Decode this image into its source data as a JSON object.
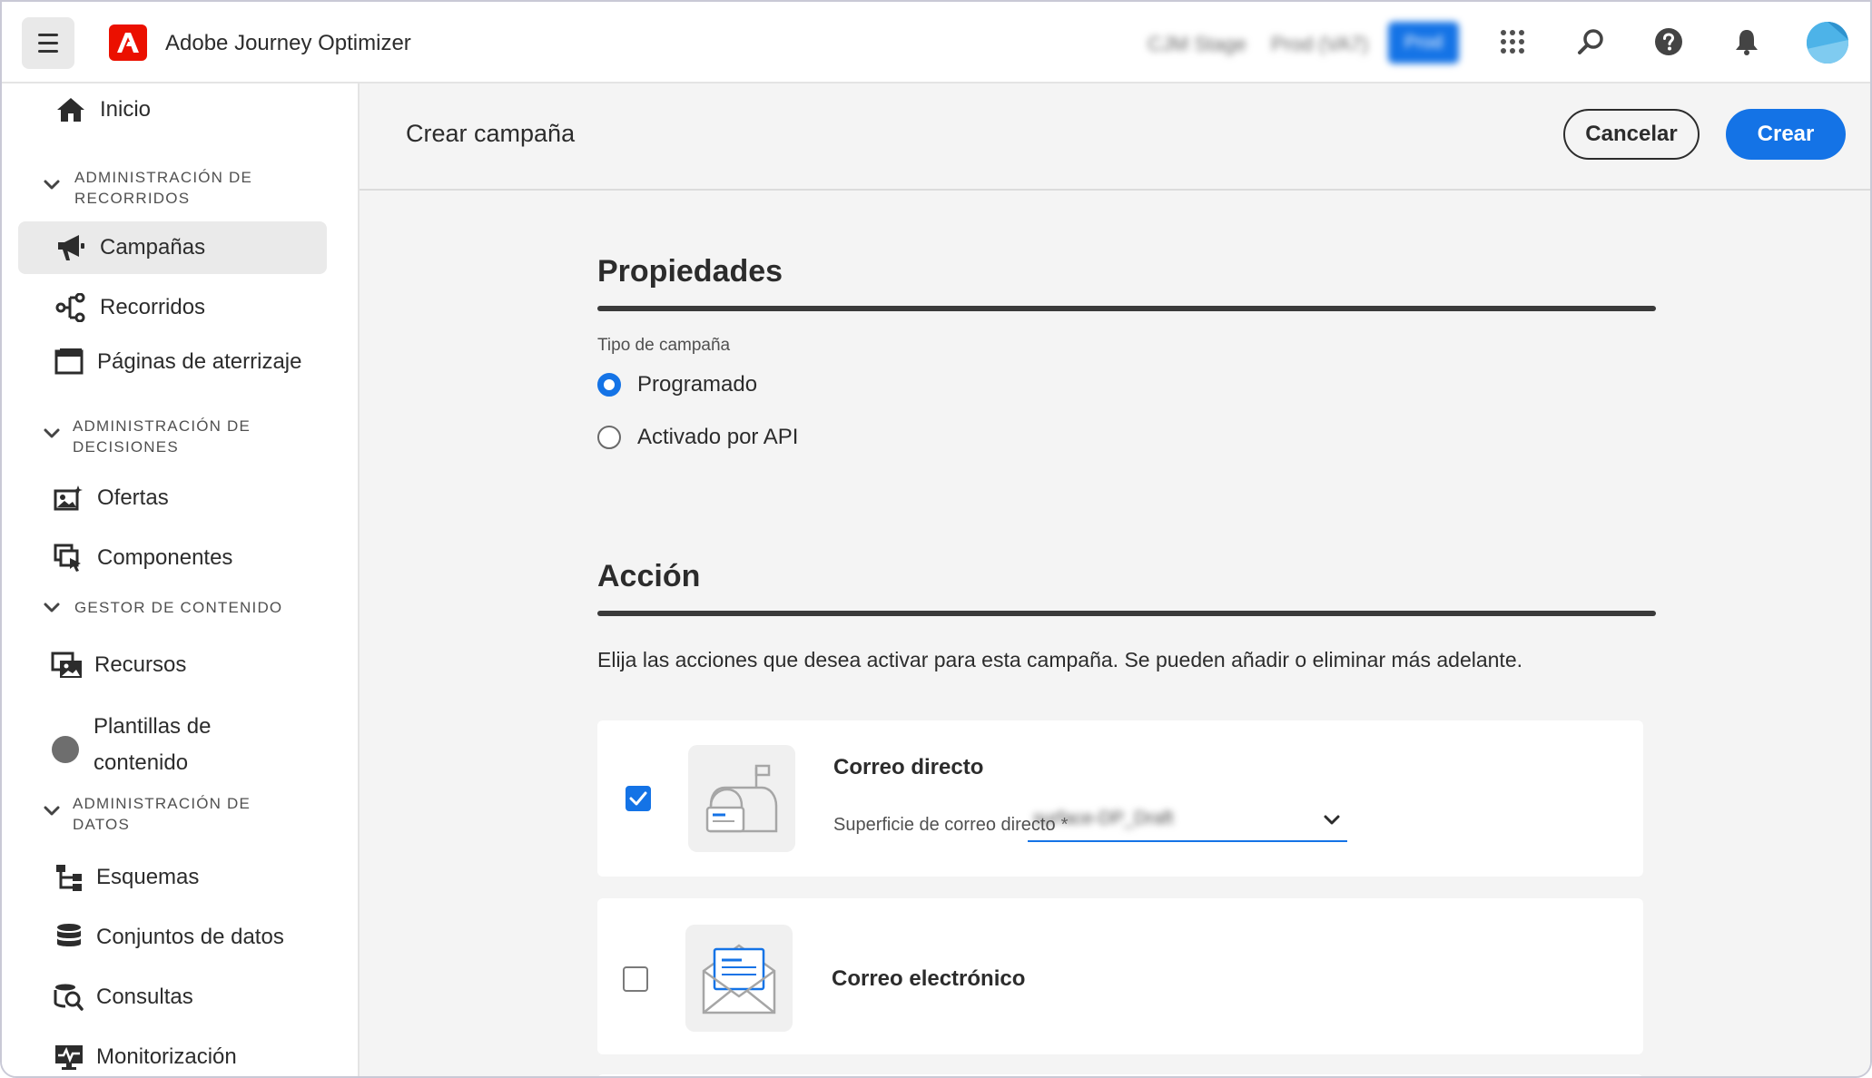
{
  "app": {
    "title": "Adobe Journey Optimizer"
  },
  "topbar": {
    "org_switcher": [
      "CJM Stage",
      "Prod (VA7)",
      "Prod"
    ],
    "icons": [
      "apps-grid-icon",
      "search-icon",
      "help-icon",
      "bell-icon",
      "avatar"
    ]
  },
  "sidebar": {
    "home": "Inicio",
    "sections": [
      {
        "label": "ADMINISTRACIÓN DE RECORRIDOS"
      },
      {
        "label": "ADMINISTRACIÓN DE DECISIONES"
      },
      {
        "label": "GESTOR DE CONTENIDO"
      },
      {
        "label": "ADMINISTRACIÓN DE DATOS"
      }
    ],
    "items": {
      "campaigns": "Campañas",
      "journeys": "Recorridos",
      "landing_pages": "Páginas de aterrizaje",
      "offers": "Ofertas",
      "components": "Componentes",
      "assets": "Recursos",
      "templates_line1": "Plantillas de",
      "templates_line2": "contenido",
      "schemas": "Esquemas",
      "datasets": "Conjuntos de datos",
      "queries": "Consultas",
      "monitoring": "Monitorización"
    },
    "active_item": "Campañas"
  },
  "header": {
    "title": "Crear campaña",
    "cancel_label": "Cancelar",
    "create_label": "Crear"
  },
  "properties": {
    "heading": "Propiedades",
    "type_label": "Tipo de campaña",
    "options": [
      {
        "label": "Programado",
        "selected": true
      },
      {
        "label": "Activado por API",
        "selected": false
      }
    ]
  },
  "action": {
    "heading": "Acción",
    "description": "Elija las acciones que desea activar para esta campaña. Se pueden añadir o eliminar más adelante.",
    "channels": [
      {
        "title": "Correo directo",
        "checked": true,
        "surface_label": "Superficie de correo directo",
        "required_mark": "*",
        "surface_value": "surface-DP_Draft"
      },
      {
        "title": "Correo electrónico",
        "checked": false
      }
    ]
  },
  "colors": {
    "accent": "#1473e6",
    "brand_red": "#eb1000"
  }
}
